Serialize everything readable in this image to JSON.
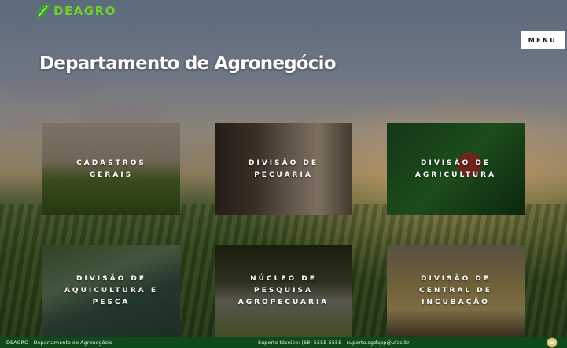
{
  "header": {
    "logo_text": "DEAGRO",
    "menu_label": "MENU"
  },
  "main": {
    "title": "Departamento de Agronegócio",
    "cards": [
      {
        "label": "CADASTROS GERAIS"
      },
      {
        "label": "DIVISÃO DE PECUARIA"
      },
      {
        "label": "DIVISÃO DE AGRICULTURA"
      },
      {
        "label": "DIVISÃO DE AQUICULTURA E PESCA"
      },
      {
        "label": "NÚCLEO DE PESQUISA AGROPECUARIA"
      },
      {
        "label": "DIVISÃO DE CENTRAL DE INCUBAÇÃO"
      }
    ]
  },
  "footer": {
    "left_text": "DEAGRO - Departamento de Agronegócio",
    "support_text": "Suporte técnico: (68) 5555-5555 | suporte.sgdapp@ufac.br"
  },
  "icons": {
    "logo": "leaf-icon",
    "seal": "university-seal-icon"
  },
  "colors": {
    "brand_green": "#6fcf2e",
    "footer_bg": "#0f4a1c",
    "menu_bg": "#ffffff"
  }
}
